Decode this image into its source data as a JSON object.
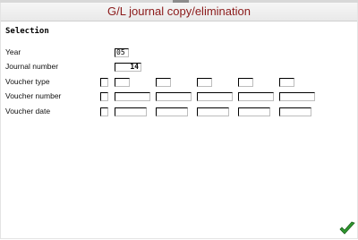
{
  "window": {
    "title": "G/L journal copy/elimination"
  },
  "section": {
    "title": "Selection"
  },
  "fields": {
    "year": {
      "label": "Year",
      "value": "05"
    },
    "journal_number": {
      "label": "Journal number",
      "value": "14"
    },
    "voucher_type": {
      "label": "Voucher type",
      "values": [
        "",
        "",
        "",
        "",
        "",
        ""
      ]
    },
    "voucher_number": {
      "label": "Voucher number",
      "values": [
        "",
        "",
        "",
        "",
        ""
      ]
    },
    "voucher_date": {
      "label": "Voucher date",
      "values": [
        "",
        "",
        "",
        "",
        ""
      ]
    }
  },
  "toolbar": {
    "ok_icon": "green-checkmark-icon"
  },
  "colors": {
    "title_text": "#8b1a1a",
    "ok_green": "#2f9a2f"
  }
}
